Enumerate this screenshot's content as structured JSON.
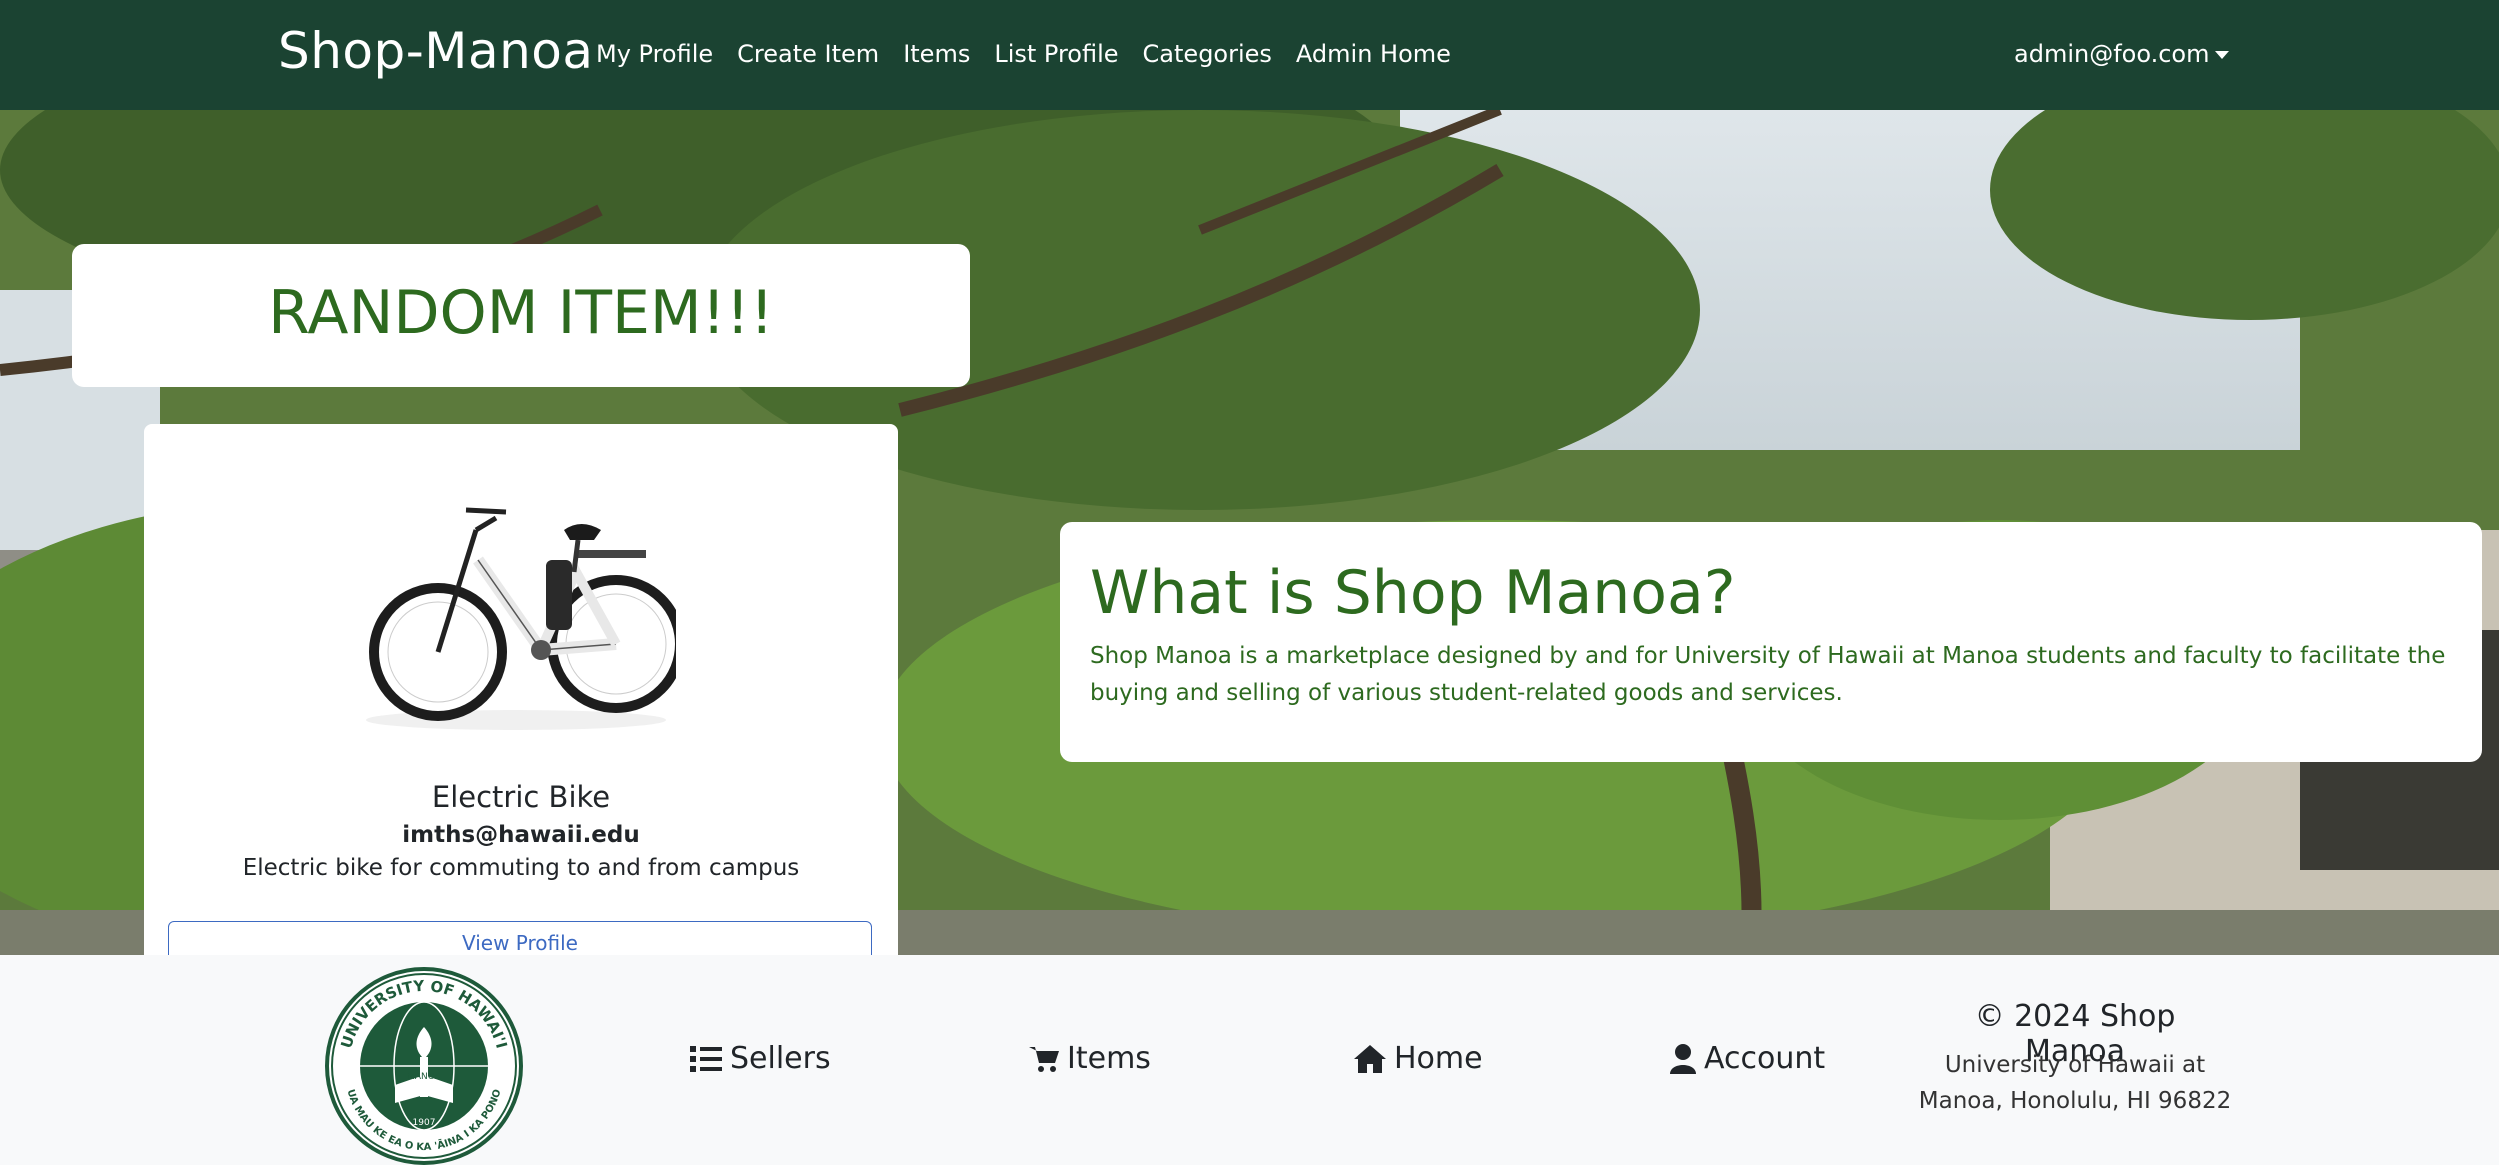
{
  "navbar": {
    "brand": "Shop-Manoa",
    "links": [
      "My Profile",
      "Create Item",
      "Items",
      "List Profile",
      "Categories",
      "Admin Home"
    ],
    "user": "admin@foo.com"
  },
  "random": {
    "title": "RANDOM ITEM!!!"
  },
  "item": {
    "name": "Electric Bike",
    "owner": "imths@hawaii.edu",
    "description": "Electric bike for commuting to and from campus",
    "button": "View Profile"
  },
  "about": {
    "title": "What is Shop Manoa?",
    "text": "Shop Manoa is a marketplace designed by and for University of Hawaii at Manoa students and faculty to facilitate the buying and selling of various student-related goods and services."
  },
  "footer": {
    "links": [
      {
        "label": "Sellers",
        "icon": "list-icon"
      },
      {
        "label": "Items",
        "icon": "cart-icon"
      },
      {
        "label": "Home",
        "icon": "home-icon"
      },
      {
        "label": "Account",
        "icon": "user-icon"
      }
    ],
    "copyright": "© 2024 Shop Manoa",
    "address": "University of Hawaii at Manoa, Honolulu, HI 96822",
    "seal": {
      "top_text": "UNIVERSITY OF HAWAI'I",
      "bottom_text": "UA MAU KE EA O KA 'ĀINA I KA PONO",
      "center_text": "MĀNOA",
      "year": "1907"
    }
  },
  "colors": {
    "navbar": "#1b4332",
    "heading_green": "#2d6a1f",
    "button_blue": "#3d6ac2"
  }
}
